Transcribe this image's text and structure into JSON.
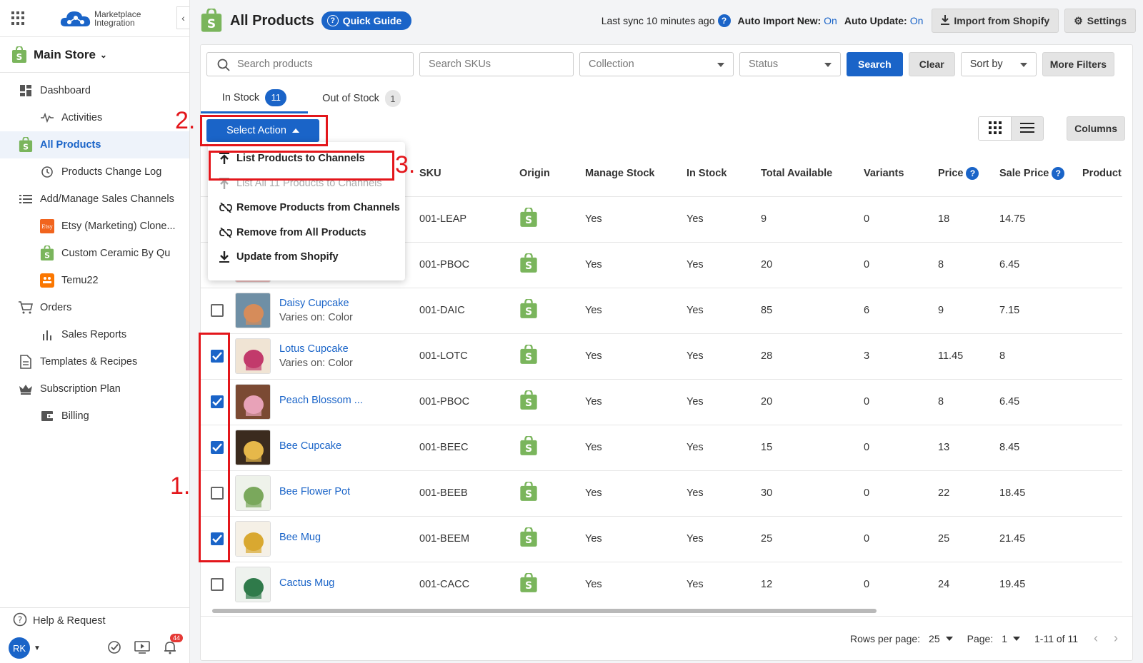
{
  "app": {
    "logo_text_1": "Marketplace",
    "logo_text_2": "Integration"
  },
  "store": {
    "name": "Main Store"
  },
  "sidebar": {
    "items": [
      {
        "label": "Dashboard"
      },
      {
        "label": "Activities"
      },
      {
        "label": "All Products"
      },
      {
        "label": "Products Change Log"
      },
      {
        "label": "Add/Manage Sales Channels"
      },
      {
        "label": "Etsy (Marketing) Clone..."
      },
      {
        "label": "Custom Ceramic By Qu"
      },
      {
        "label": "Temu22"
      },
      {
        "label": "Orders"
      },
      {
        "label": "Sales Reports"
      },
      {
        "label": "Templates & Recipes"
      },
      {
        "label": "Subscription Plan"
      },
      {
        "label": "Billing"
      }
    ],
    "help": "Help & Request",
    "avatar": "RK",
    "notifications": "44"
  },
  "header": {
    "title": "All Products",
    "quick_guide": "Quick Guide",
    "last_sync": "Last sync 10 minutes ago",
    "auto_import_label": "Auto Import New:",
    "auto_import_value": "On",
    "auto_update_label": "Auto Update:",
    "auto_update_value": "On",
    "import_btn": "Import from Shopify",
    "settings_btn": "Settings"
  },
  "filters": {
    "search_products": "Search products",
    "search_skus": "Search SKUs",
    "collection": "Collection",
    "status": "Status",
    "search_btn": "Search",
    "clear_btn": "Clear",
    "sort_by": "Sort by",
    "more_filters": "More Filters"
  },
  "tabs": [
    {
      "label": "In Stock",
      "count": "11"
    },
    {
      "label": "Out of Stock",
      "count": "1"
    }
  ],
  "actions": {
    "select_action": "Select Action",
    "columns": "Columns",
    "menu": [
      {
        "label": "List Products to Channels"
      },
      {
        "label": "List All 11 Products to Channels"
      },
      {
        "label": "Remove Products from Channels"
      },
      {
        "label": "Remove from All Products"
      },
      {
        "label": "Update from Shopify"
      }
    ]
  },
  "table": {
    "headers": {
      "sku": "SKU",
      "origin": "Origin",
      "manage_stock": "Manage Stock",
      "in_stock": "In Stock",
      "total_available": "Total Available",
      "variants": "Variants",
      "price": "Price",
      "sale_price": "Sale Price",
      "product": "Product"
    },
    "rows": [
      {
        "name": "",
        "variant": "",
        "sku": "001-LEAP",
        "manage": "Yes",
        "instock": "Yes",
        "total": "9",
        "variants": "0",
        "price": "18",
        "sale": "14.75",
        "checked": false
      },
      {
        "name": "",
        "variant": "",
        "sku": "001-PBOC",
        "manage": "Yes",
        "instock": "Yes",
        "total": "20",
        "variants": "0",
        "price": "8",
        "sale": "6.45",
        "checked": false
      },
      {
        "name": "Daisy Cupcake",
        "variant": "Varies on: Color",
        "sku": "001-DAIC",
        "manage": "Yes",
        "instock": "Yes",
        "total": "85",
        "variants": "6",
        "price": "9",
        "sale": "7.15",
        "checked": false
      },
      {
        "name": "Lotus Cupcake",
        "variant": "Varies on: Color",
        "sku": "001-LOTC",
        "manage": "Yes",
        "instock": "Yes",
        "total": "28",
        "variants": "3",
        "price": "11.45",
        "sale": "8",
        "checked": true
      },
      {
        "name": "Peach Blossom ...",
        "variant": "",
        "sku": "001-PBOC",
        "manage": "Yes",
        "instock": "Yes",
        "total": "20",
        "variants": "0",
        "price": "8",
        "sale": "6.45",
        "checked": true
      },
      {
        "name": "Bee Cupcake",
        "variant": "",
        "sku": "001-BEEC",
        "manage": "Yes",
        "instock": "Yes",
        "total": "15",
        "variants": "0",
        "price": "13",
        "sale": "8.45",
        "checked": true
      },
      {
        "name": "Bee Flower Pot",
        "variant": "",
        "sku": "001-BEEB",
        "manage": "Yes",
        "instock": "Yes",
        "total": "30",
        "variants": "0",
        "price": "22",
        "sale": "18.45",
        "checked": false
      },
      {
        "name": "Bee Mug",
        "variant": "",
        "sku": "001-BEEM",
        "manage": "Yes",
        "instock": "Yes",
        "total": "25",
        "variants": "0",
        "price": "25",
        "sale": "21.45",
        "checked": true
      },
      {
        "name": "Cactus Mug",
        "variant": "",
        "sku": "001-CACC",
        "manage": "Yes",
        "instock": "Yes",
        "total": "12",
        "variants": "0",
        "price": "24",
        "sale": "19.45",
        "checked": false
      }
    ]
  },
  "pagination": {
    "rows_label": "Rows per page:",
    "rows_value": "25",
    "page_label": "Page:",
    "page_value": "1",
    "range": "1-11 of 11"
  },
  "annotations": {
    "a1": "1.",
    "a2": "2.",
    "a3": "3."
  },
  "colors": {
    "accent": "#1a64c8",
    "annotation": "#e3161b",
    "shopify": "#7ab55c"
  }
}
